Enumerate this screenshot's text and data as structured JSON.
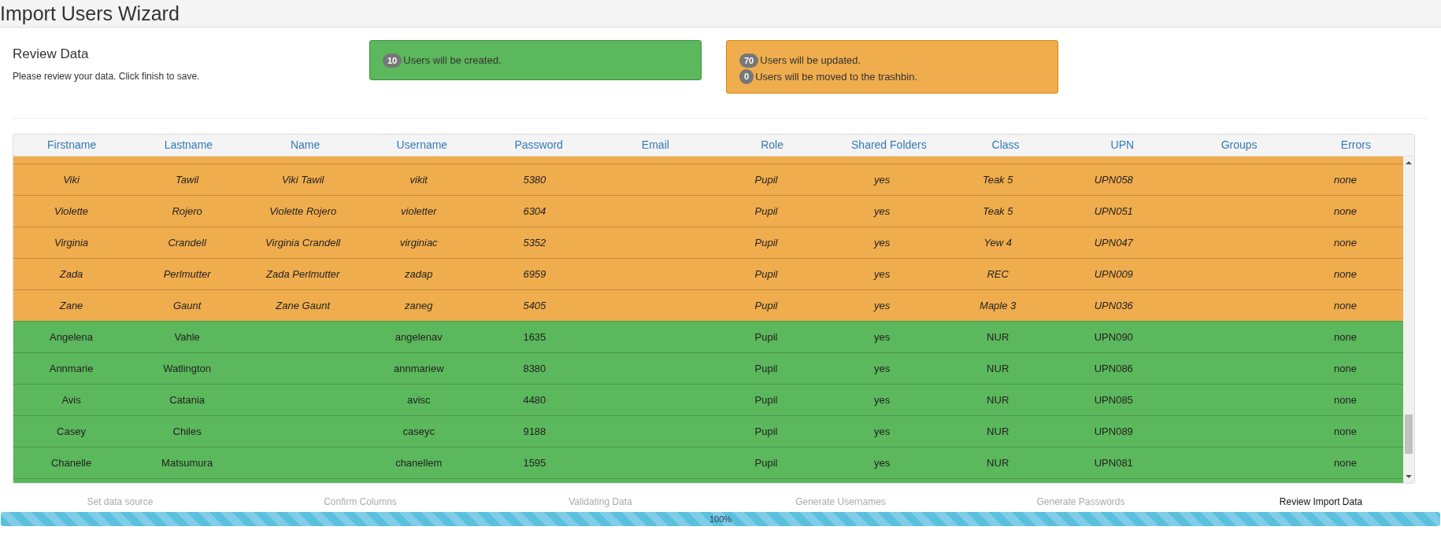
{
  "window": {
    "title": "Import Users Wizard"
  },
  "section": {
    "title": "Review Data",
    "subtitle": "Please review your data. Click finish to save."
  },
  "alerts": [
    {
      "kind": "create",
      "lines": [
        {
          "count": "10",
          "text": "Users will be created."
        }
      ]
    },
    {
      "kind": "update",
      "lines": [
        {
          "count": "70",
          "text": "Users will be updated."
        },
        {
          "count": "0",
          "text": "Users will be moved to the trashbin."
        }
      ]
    }
  ],
  "table": {
    "columns": [
      "Firstname",
      "Lastname",
      "Name",
      "Username",
      "Password",
      "Email",
      "Role",
      "Shared Folders",
      "Class",
      "UPN",
      "Groups",
      "Errors"
    ],
    "rows": [
      {
        "kind": "update",
        "cells": [
          "Viki",
          "Tawil",
          "Viki Tawil",
          "vikit",
          "5380",
          "",
          "Pupil",
          "yes",
          "Teak 5",
          "UPN058",
          "",
          "none"
        ]
      },
      {
        "kind": "update",
        "cells": [
          "Violette",
          "Rojero",
          "Violette Rojero",
          "violetter",
          "6304",
          "",
          "Pupil",
          "yes",
          "Teak 5",
          "UPN051",
          "",
          "none"
        ]
      },
      {
        "kind": "update",
        "cells": [
          "Virginia",
          "Crandell",
          "Virginia Crandell",
          "virginiac",
          "5352",
          "",
          "Pupil",
          "yes",
          "Yew 4",
          "UPN047",
          "",
          "none"
        ]
      },
      {
        "kind": "update",
        "cells": [
          "Zada",
          "Perlmutter",
          "Zada Perlmutter",
          "zadap",
          "6959",
          "",
          "Pupil",
          "yes",
          "REC",
          "UPN009",
          "",
          "none"
        ]
      },
      {
        "kind": "update",
        "cells": [
          "Zane",
          "Gaunt",
          "Zane Gaunt",
          "zaneg",
          "5405",
          "",
          "Pupil",
          "yes",
          "Maple 3",
          "UPN036",
          "",
          "none"
        ]
      },
      {
        "kind": "create",
        "cells": [
          "Angelena",
          "Vahle",
          "",
          "angelenav",
          "1635",
          "",
          "Pupil",
          "yes",
          "NUR",
          "UPN090",
          "",
          "none"
        ]
      },
      {
        "kind": "create",
        "cells": [
          "Annmarie",
          "Watlington",
          "",
          "annmariew",
          "8380",
          "",
          "Pupil",
          "yes",
          "NUR",
          "UPN086",
          "",
          "none"
        ]
      },
      {
        "kind": "create",
        "cells": [
          "Avis",
          "Catania",
          "",
          "avisc",
          "4480",
          "",
          "Pupil",
          "yes",
          "NUR",
          "UPN085",
          "",
          "none"
        ]
      },
      {
        "kind": "create",
        "cells": [
          "Casey",
          "Chiles",
          "",
          "caseyc",
          "9188",
          "",
          "Pupil",
          "yes",
          "NUR",
          "UPN089",
          "",
          "none"
        ]
      },
      {
        "kind": "create",
        "cells": [
          "Chanelle",
          "Matsumura",
          "",
          "chanellem",
          "1595",
          "",
          "Pupil",
          "yes",
          "NUR",
          "UPN081",
          "",
          "none"
        ]
      }
    ]
  },
  "steps": [
    {
      "label": "Set data source",
      "selected": false
    },
    {
      "label": "Confirm Columns",
      "selected": false
    },
    {
      "label": "Validating Data",
      "selected": false
    },
    {
      "label": "Generate Usernames",
      "selected": false
    },
    {
      "label": "Generate Passwords",
      "selected": false
    },
    {
      "label": "Review Import Data",
      "selected": true
    }
  ],
  "progress": {
    "level": 1,
    "label": "100%"
  }
}
